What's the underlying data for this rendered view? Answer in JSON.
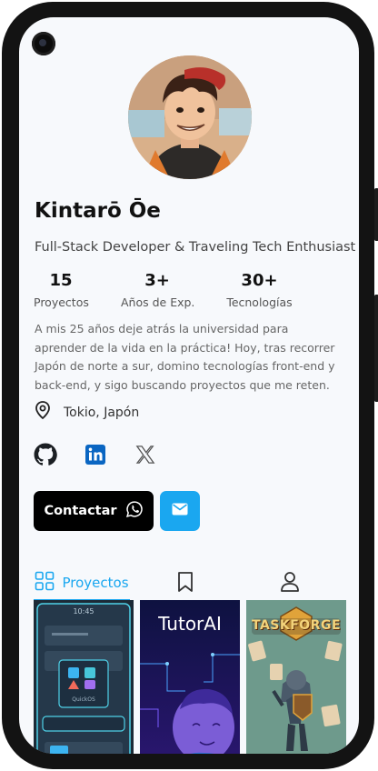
{
  "profile": {
    "name": "Kintarō Ōe",
    "headline": "Full-Stack Developer & Traveling Tech Enthusiast",
    "bio": "A mis 25 años deje atrás la universidad para aprender de la vida en la práctica! Hoy, tras recorrer Japón de norte a sur, domino tecnologías front-end y back-end, y sigo buscando proyectos que me reten.",
    "location": "Tokio, Japón"
  },
  "stats": [
    {
      "value": "15",
      "label": "Proyectos"
    },
    {
      "value": "3+",
      "label": "Años de Exp."
    },
    {
      "value": "30+",
      "label": "Tecnologías"
    }
  ],
  "socials": [
    "github-icon",
    "linkedin-icon",
    "x-icon"
  ],
  "actions": {
    "contact_label": "Contactar",
    "contact_icon": "whatsapp-icon",
    "mail_icon": "mail-icon"
  },
  "tabs": [
    {
      "label": "Proyectos",
      "icon": "grid-icon",
      "active": true
    },
    {
      "label": "",
      "icon": "bookmark-icon",
      "active": false
    },
    {
      "label": "",
      "icon": "user-icon",
      "active": false
    }
  ],
  "projects": [
    {
      "title": "",
      "time": "10:45",
      "app_label": "QuickOS"
    },
    {
      "title": "TutorAI"
    },
    {
      "title": "TASKFORGE"
    }
  ],
  "colors": {
    "accent": "#1aa7f0",
    "primary_button": "#000000",
    "background": "#f7f9fc"
  }
}
